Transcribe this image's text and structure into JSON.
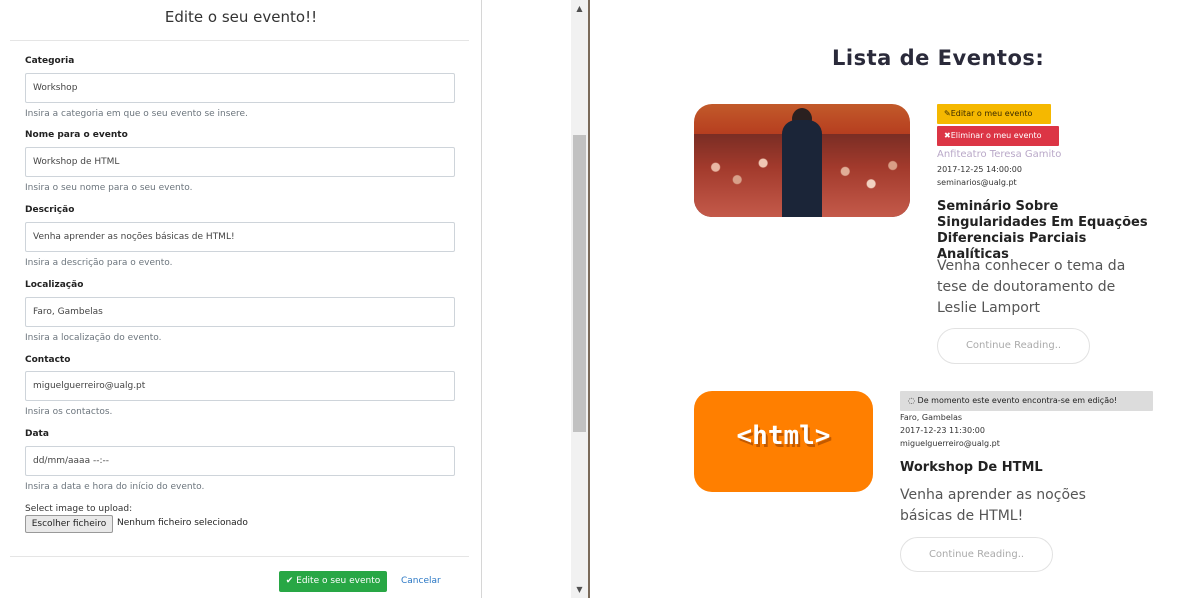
{
  "modal": {
    "title": "Edite o seu evento!!",
    "fields": [
      {
        "label": "Categoria",
        "value": "Workshop",
        "help": "Insira a categoria em que o seu evento se insere."
      },
      {
        "label": "Nome para o evento",
        "value": "Workshop de HTML",
        "help": "Insira o seu nome para o seu evento."
      },
      {
        "label": "Descrição",
        "value": "Venha aprender as noções básicas de HTML!",
        "help": "Insira a descrição para o evento."
      },
      {
        "label": "Localização",
        "value": "Faro, Gambelas",
        "help": "Insira a localização do evento."
      },
      {
        "label": "Contacto",
        "value": "miguelguerreiro@ualg.pt",
        "help": "Insira os contactos."
      },
      {
        "label": "Data",
        "value": "dd/mm/aaaa --:--",
        "help": "Insira a data e hora do início do evento."
      }
    ],
    "upload_label": "Select image to upload:",
    "file_button": "Escolher ficheiro",
    "file_status": "Nenhum ficheiro selecionado",
    "save_button": "Edite o seu evento",
    "cancel_link": "Cancelar"
  },
  "scrollbar": {
    "up": "▲",
    "down": "▼"
  },
  "page": {
    "heading": "Lista de Eventos:",
    "events": [
      {
        "image_label": "",
        "edit_badge": "Editar o meu evento",
        "delete_badge": "Eliminar o meu evento",
        "location": "Anfiteatro Teresa Gamito",
        "date": "2017-12-25 14:00:00",
        "contact": "seminarios@ualg.pt",
        "title": "Seminário Sobre Singularidades Em Equações Diferenciais Parciais Analíticas",
        "description": "Venha conhecer o tema da tese de doutoramento de Leslie Lamport",
        "button": "Continue Reading.."
      },
      {
        "image_label": "<html>",
        "pending_badge": "De momento este evento encontra-se em edição!",
        "location": "Faro, Gambelas",
        "date": "2017-12-23 11:30:00",
        "contact": "miguelguerreiro@ualg.pt",
        "title": "Workshop De HTML",
        "description": "Venha aprender as noções básicas de HTML!",
        "button": "Continue Reading.."
      }
    ]
  },
  "colors": {
    "success": "#28a745",
    "warning": "#f5b800",
    "danger": "#dc3545",
    "html_orange": "#ff7f00"
  }
}
